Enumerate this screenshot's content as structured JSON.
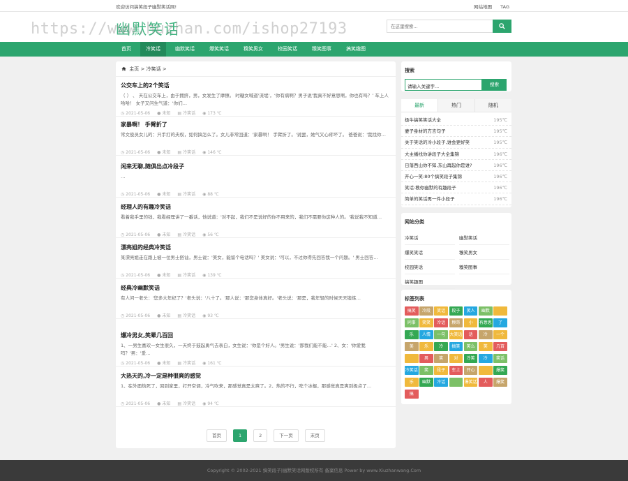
{
  "topbar": {
    "welcome": "欢迎访问搞笑段子幽默笑话网!",
    "links": [
      "网站地图",
      "TAG"
    ]
  },
  "header": {
    "logo": "幽默笑话",
    "watermark": "https://www.huzhan.com/ishop27193",
    "search_placeholder": "在这里搜索..."
  },
  "nav": {
    "items": [
      "首页",
      "冷笑话",
      "幽默笑话",
      "爆笑笑话",
      "糗笑男女",
      "校园笑话",
      "糗笑图事",
      "搞笑趣图"
    ],
    "active_index": 1
  },
  "breadcrumb": {
    "home": "主页",
    "sep": ">",
    "current": "冷笑话",
    "tail": ">"
  },
  "articles": [
    {
      "title": "公交车上的2个笑话",
      "excerpt": "（ ）  、 天在公交车上，由于拥挤，男，女发生了摩擦。 时糖女喊道'流氓'，‘你有病啊？男子说'我真不好意思啊，你也有吗？’ 车上人哈哈！  女子又问生气道：‘你们…",
      "date": "2021-05-06",
      "author": "未知",
      "category": "冷笑话",
      "views": "173 ℃"
    },
    {
      "title": "家暴啊！ 手臂折了",
      "excerpt": "常文俊员女儿的：只手打的夫权，如何搞怎么了。女儿非常回道：'家暴啊！ 手臂折了。'说罢，她气又心疼坏了。 爸爸说：'我找你…",
      "date": "2021-05-06",
      "author": "未知",
      "category": "冷笑话",
      "views": "146 ℃"
    },
    {
      "title": "闲来无聊,随俱出点冷段子",
      "excerpt": "…",
      "date": "2021-05-06",
      "author": "未知",
      "category": "冷笑话",
      "views": "88 ℃"
    },
    {
      "title": "经理人的有趣冷笑话",
      "excerpt": "看着我手里的钱，我看经理讲了一番话，他说道：'对不起，我们不是说好的你不用来的，我们不需要你这种人的。'我说我不知道…",
      "date": "2021-05-06",
      "author": "未知",
      "category": "冷笑话",
      "views": "56 ℃"
    },
    {
      "title": "漂亮姐的经典冷笑话",
      "excerpt": "某漂亮姐走在路上被一位男士搭讪，男士说：'美女，能留个电话吗？' 美女说：'可以，不过你得先回答我一个问题。' 男士回答…",
      "date": "2021-05-06",
      "author": "未知",
      "category": "冷笑话",
      "views": "139 ℃"
    },
    {
      "title": "经典冷幽默笑话",
      "excerpt": "有人问一老头：'您多大年纪了？'老头说：'八十了。'那人说：'那您身体真好。'老头说：'那是，我年轻的时候天天锻炼…",
      "date": "2021-05-06",
      "author": "未知",
      "category": "冷笑话",
      "views": "93 ℃"
    },
    {
      "title": "爆冷男女,笑晕几百回",
      "excerpt": "1、一男生喜欢一女生很久，一天终于鼓起勇气去表白，女生说：'你是个好人。'男生说：'那我们能不能…' 2、女：'你爱我吗？'男：'爱…",
      "date": "2021-05-06",
      "author": "未知",
      "category": "冷笑话",
      "views": "161 ℃"
    },
    {
      "title": "大热天的,冷一定是种很爽的感觉",
      "excerpt": "1、在外面热死了，回到家里，打开空调，冷气吹来，那感觉真是太爽了。2、热的不行，吃个冰棍，那感觉真是爽到极点了…",
      "date": "2021-05-06",
      "author": "未知",
      "category": "冷笑话",
      "views": "94 ℃"
    }
  ],
  "pager": [
    "首页",
    "1",
    "2",
    "下一页",
    "末页"
  ],
  "sidebar": {
    "search_title": "搜索",
    "search_value": "请输入关键字...",
    "search_button": "搜索",
    "tabs": [
      "最新",
      "热门",
      "随机"
    ],
    "hot": [
      {
        "title": "极牛搞笑笑话大全",
        "temp": "195℃"
      },
      {
        "title": "妻子身材的方言句子",
        "temp": "195℃"
      },
      {
        "title": "关于笑话的冷小段子,谁会更好笑",
        "temp": "195℃"
      },
      {
        "title": "大主播找你讲段子大全集锦",
        "temp": "196℃"
      },
      {
        "title": "日落西山你不知,东山再起你是谁?",
        "temp": "196℃"
      },
      {
        "title": "开心一笑:80个搞笑段子集锦",
        "temp": "196℃"
      },
      {
        "title": "笑话:教你幽默的有趣段子",
        "temp": "196℃"
      },
      {
        "title": "简单的笑话再一件小段子",
        "temp": "196℃"
      }
    ],
    "category_title": "网站分类",
    "categories": [
      "冷笑话",
      "幽默笑话",
      "爆笑笑话",
      "糗笑男女",
      "校园笑话",
      "糗笑图事",
      "搞笑趣图"
    ],
    "tags_title": "标签列表",
    "tags": [
      "搞笑",
      "冷段",
      "笑话",
      "段子",
      "笑人",
      "幽默",
      "",
      "同事",
      "笑笑",
      "冷话",
      "糗哥",
      "小",
      "有意思",
      "了",
      "乐",
      "人情",
      "一句",
      "大笑话",
      "话",
      "冷",
      "一个",
      "美",
      "乐",
      "冷",
      "搞笑",
      "笑么",
      "笑",
      "几百",
      "",
      "男",
      "笑",
      "对",
      "冷笑",
      "冷",
      "笑话",
      "冷笑话",
      "笑",
      "段子",
      "车上",
      "开心",
      "",
      "爆笑",
      "乐",
      "幽默",
      "冷话",
      "",
      "爆笑话",
      "人",
      "爆笑",
      "搞"
    ],
    "tag_colors": [
      "#e35c5c",
      "#7cc067",
      "#34a853",
      "#c6a56b",
      "#f0b93c",
      "#25a8e0",
      "#f0b93c"
    ]
  },
  "footer": "Copyright © 2002-2021 搞笑段子|幽默笑话网版权所有 备案信息 Power by www.Xiuzhanwang.Com"
}
